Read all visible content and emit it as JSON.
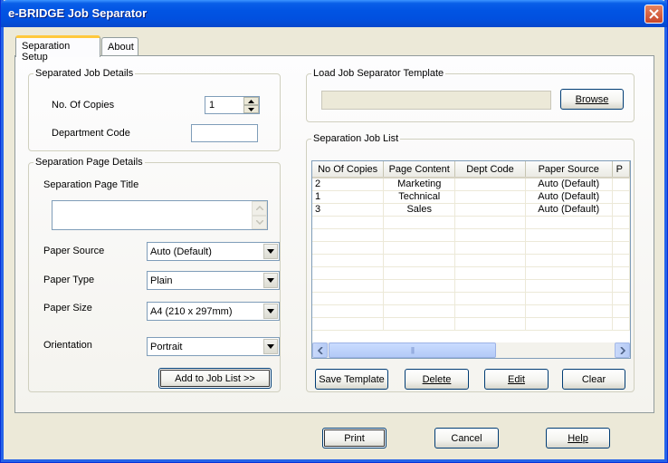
{
  "window": {
    "title": "e-BRIDGE Job Separator"
  },
  "tabs": [
    {
      "label": "Separation Setup",
      "active": true
    },
    {
      "label": "About",
      "active": false
    }
  ],
  "separated_job_details": {
    "legend": "Separated Job Details",
    "copies_label": "No. Of Copies",
    "copies_value": "1",
    "department_label": "Department Code",
    "department_value": ""
  },
  "separation_page_details": {
    "legend": "Separation Page Details",
    "title_label": "Separation Page Title",
    "title_value": "",
    "paper_source_label": "Paper Source",
    "paper_source_value": "Auto (Default)",
    "paper_type_label": "Paper Type",
    "paper_type_value": "Plain",
    "paper_size_label": "Paper Size",
    "paper_size_value": "A4 (210 x 297mm)",
    "orientation_label": "Orientation",
    "orientation_value": "Portrait",
    "add_button": "Add to Job List >>"
  },
  "load_template": {
    "legend": "Load Job Separator Template",
    "path_value": "",
    "browse_button": "Browse"
  },
  "job_list": {
    "legend": "Separation Job List",
    "columns": [
      "No Of Copies",
      "Page Content",
      "Dept Code",
      "Paper Source",
      "P"
    ],
    "rows": [
      [
        "2",
        "Marketing",
        "",
        "Auto (Default)",
        ""
      ],
      [
        "1",
        "Technical",
        "",
        "Auto (Default)",
        ""
      ],
      [
        "3",
        "Sales",
        "",
        "Auto (Default)",
        ""
      ]
    ],
    "scroll_thumb_grip": "|||",
    "save_button": "Save Template",
    "delete_button": "Delete",
    "edit_button": "Edit",
    "clear_button": "Clear"
  },
  "footer": {
    "print_button": "Print",
    "cancel_button": "Cancel",
    "help_button": "Help"
  },
  "colors": {
    "titlebar": "#0154e3",
    "tab_highlight": "#ffc83c",
    "window_bg": "#ece9d8"
  }
}
